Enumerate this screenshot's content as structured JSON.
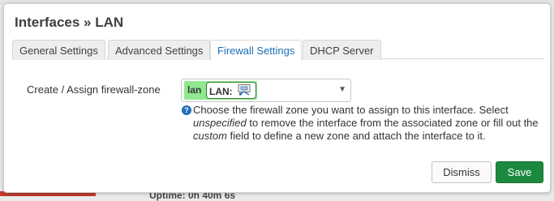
{
  "modal": {
    "title": "Interfaces » LAN"
  },
  "tabs": [
    {
      "label": "General Settings",
      "active": false
    },
    {
      "label": "Advanced Settings",
      "active": false
    },
    {
      "label": "Firewall Settings",
      "active": true
    },
    {
      "label": "DHCP Server",
      "active": false
    }
  ],
  "form": {
    "label": "Create / Assign firewall-zone",
    "zone": {
      "name": "lan",
      "interface": "LAN:",
      "interface_icon": "network-port-icon",
      "badge_color": "#90e890",
      "dropdown_icon": "caret-down-icon"
    },
    "help": {
      "icon": "question-circle-icon",
      "p1": "Choose the firewall zone you want to assign to this interface. Select ",
      "em1": "unspecified",
      "p2": " to remove the interface from the associated zone or fill out the ",
      "em2": "custom",
      "p3": " field to define a new zone and attach the interface to it."
    }
  },
  "buttons": {
    "dismiss": "Dismiss",
    "save": "Save",
    "save_color": "#1b8a3e"
  },
  "backdrop": {
    "uptime_text": "Uptime: 0h 40m 6s"
  }
}
